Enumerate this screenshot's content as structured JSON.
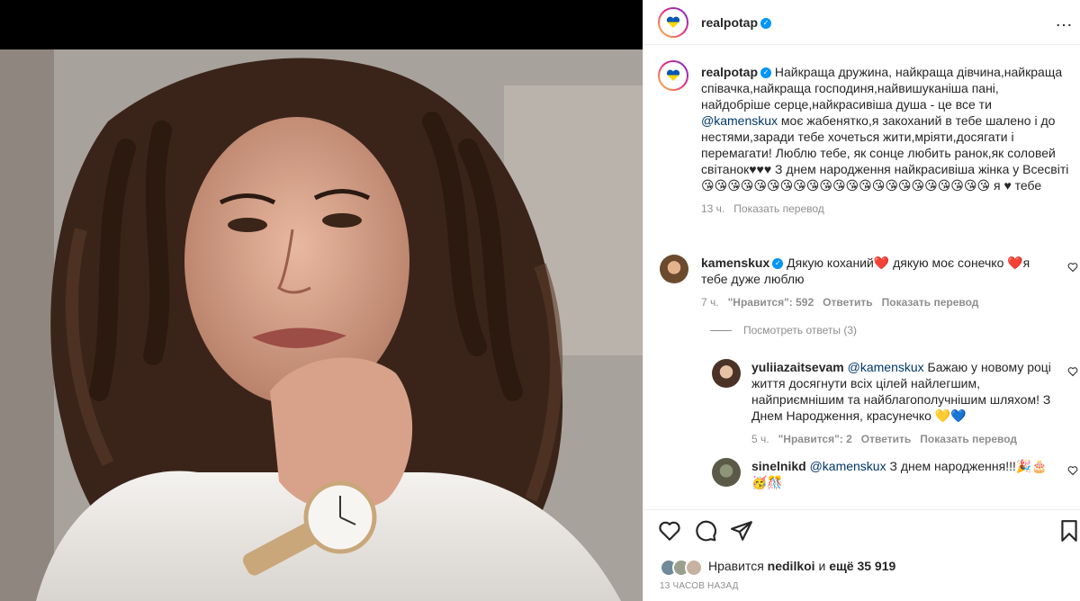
{
  "post": {
    "username": "realpotap",
    "verified_mark": "✓",
    "more_icon": "…"
  },
  "caption": {
    "username": "realpotap",
    "text_1": " Найкраща дружина, найкраща дівчина,найкраща співачка,найкраща господиня,найвишуканіша пані, найдобріше серце,найкрасивіша душа - це все ти ",
    "mention": "@kamenskux",
    "text_2": " моє жабенятко,я закоханий в тебе шалено і до нестями,заради тебе хочеться жити,мріяти,досягати і перемагати! Люблю тебе, як сонце любить ранок,як соловей світанок♥♥♥ З днем народження найкрасивіша жінка у Всесвіті 😘😘😘😘😘😘😘😘😘😘😘😘😘😘😘😘😘😘😘😘😘😘 я ♥ тебе",
    "time": "13 ч.",
    "translate": "Показать перевод"
  },
  "comments": [
    {
      "username": "kamenskux",
      "text": " Дякую коханий❤️ дякую моє сонечко ❤️я тебе дуже люблю",
      "time": "7 ч.",
      "likes": "\"Нравится\": 592",
      "reply": "Ответить",
      "translate": "Показать перевод"
    }
  ],
  "view_replies": "Посмотреть ответы (3)",
  "replies": [
    {
      "username": "yuliiazaitsevam",
      "mention": "@kamenskux",
      "text": " Бажаю у новому році життя досягнути всіх цілей найлегшим, найприємнішим та найблагополучнішим шляхом! З Днем Народження, красунечко 💛💙",
      "time": "5 ч.",
      "likes": "\"Нравится\": 2",
      "reply": "Ответить",
      "translate": "Показать перевод"
    },
    {
      "username": "sinelnikd",
      "mention": "@kamenskux",
      "text": " З днем народження!!!🎉🎂 🥳🎊"
    }
  ],
  "likes": {
    "prefix": "Нравится ",
    "user": "nedilkoi",
    "middle": " и ",
    "count": "ещё 35 919"
  },
  "posted": "13 ЧАСОВ НАЗАД",
  "icons": {
    "like": "heart-icon",
    "comment": "comment-icon",
    "share": "share-icon",
    "save": "bookmark-icon"
  }
}
